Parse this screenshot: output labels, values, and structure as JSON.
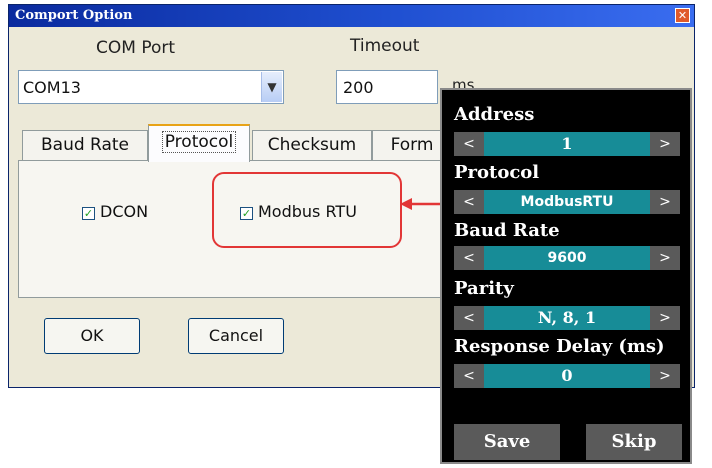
{
  "dialog": {
    "title": "Comport Option",
    "close_glyph": "✕",
    "com_port_label": "COM Port",
    "com_port_value": "COM13",
    "timeout_label": "Timeout",
    "timeout_value": "200",
    "timeout_unit": "ms",
    "tabs": [
      "Baud Rate",
      "Protocol",
      "Checksum",
      "Form"
    ],
    "active_tab": "Protocol",
    "protocols": [
      {
        "label": "DCON",
        "checked": true
      },
      {
        "label": "Modbus RTU",
        "checked": true
      }
    ],
    "ok_label": "OK",
    "cancel_label": "Cancel"
  },
  "device": {
    "prev_glyph": "<",
    "next_glyph": ">",
    "fields": [
      {
        "label": "Address",
        "value": "1"
      },
      {
        "label": "Protocol",
        "value": "ModbusRTU"
      },
      {
        "label": "Baud Rate",
        "value": "9600"
      },
      {
        "label": "Parity",
        "value": "N, 8, 1"
      },
      {
        "label": "Response Delay (ms)",
        "value": "0"
      }
    ],
    "save_label": "Save",
    "skip_label": "Skip"
  },
  "colors": {
    "title_bar": "#1f4fd0",
    "highlight": "#e23636",
    "device_value_bg": "#178c97",
    "device_bg": "#000000"
  },
  "icons": [
    "close-icon",
    "chevron-down-icon",
    "checkmark-icon",
    "double-arrow-icon"
  ]
}
